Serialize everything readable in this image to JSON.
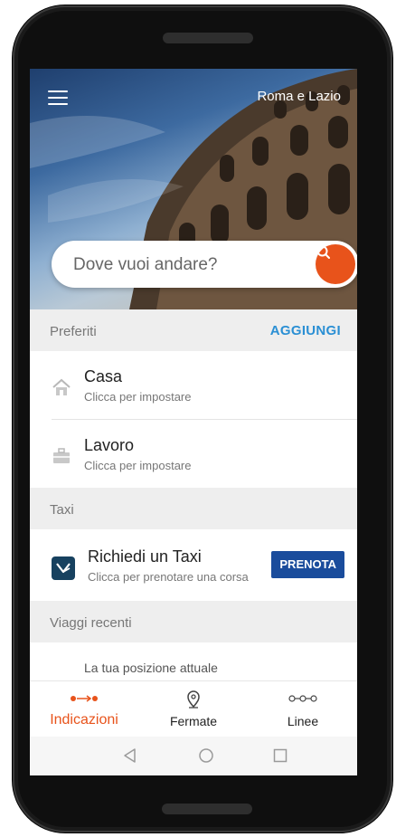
{
  "header": {
    "region": "Roma e Lazio"
  },
  "search": {
    "placeholder": "Dove vuoi andare?"
  },
  "favorites": {
    "title": "Preferiti",
    "action": "AGGIUNGI",
    "items": [
      {
        "title": "Casa",
        "subtitle": "Clicca per impostare",
        "icon": "home-icon"
      },
      {
        "title": "Lavoro",
        "subtitle": "Clicca per impostare",
        "icon": "briefcase-icon"
      }
    ]
  },
  "taxi": {
    "title": "Taxi",
    "item_title": "Richiedi un Taxi",
    "item_subtitle": "Clicca per prenotare una corsa",
    "button": "PRENOTA"
  },
  "recent": {
    "title": "Viaggi recenti",
    "items": [
      {
        "title": "La tua posizione attuale"
      }
    ]
  },
  "tabs": [
    {
      "label": "Indicazioni",
      "icon": "directions-icon",
      "active": true
    },
    {
      "label": "Fermate",
      "icon": "location-pin-icon",
      "active": false
    },
    {
      "label": "Linee",
      "icon": "lines-icon",
      "active": false
    }
  ],
  "colors": {
    "accent": "#e8531b",
    "link": "#2a8fd4",
    "taxi_brand": "#17415f",
    "button": "#1a4c9c"
  }
}
